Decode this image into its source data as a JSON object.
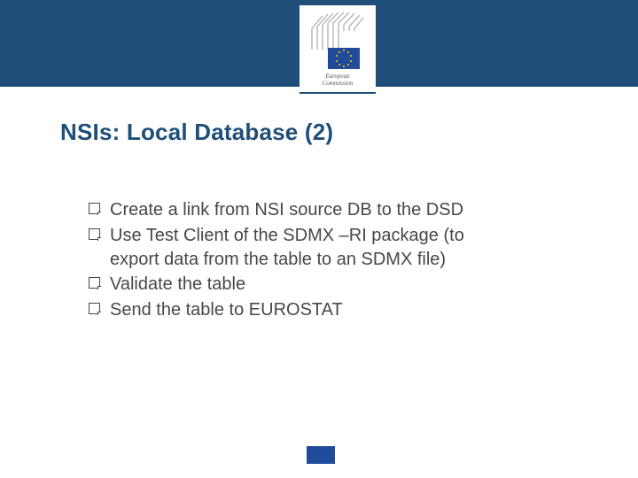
{
  "header": {
    "logo_alt": "European Commission",
    "logo_text_line1": "European",
    "logo_text_line2": "Commission"
  },
  "title": "NSIs: Local Database (2)",
  "bullets": [
    "Create a link from NSI source DB to the DSD",
    "Use Test Client of the SDMX –RI package (to export data from the table to an SDMX file)",
    "Validate the table",
    "Send the table to EUROSTAT"
  ],
  "colors": {
    "brand_primary": "#1f4e79",
    "text_body": "#474747",
    "eu_blue": "#204a9a",
    "eu_gold": "#ffd400"
  }
}
